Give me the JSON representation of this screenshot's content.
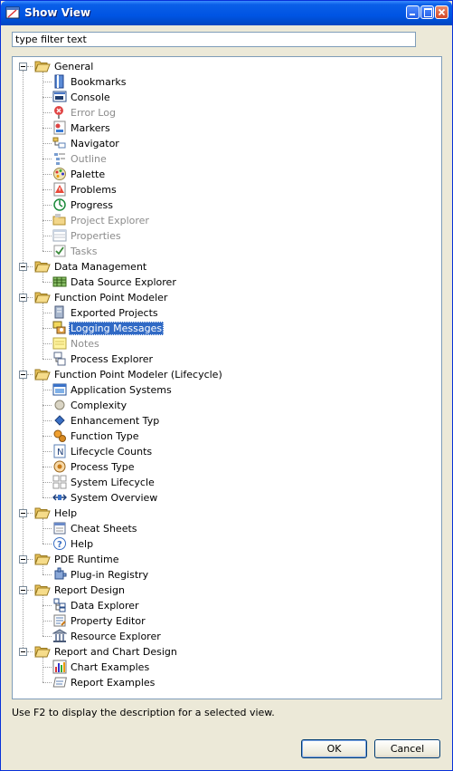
{
  "window": {
    "title": "Show View",
    "icon": "show-view-icon"
  },
  "filter": {
    "value": "type filter text"
  },
  "tree": [
    {
      "label": "General",
      "views": [
        {
          "label": "Bookmarks",
          "icon": "bookmarks-icon"
        },
        {
          "label": "Console",
          "icon": "console-icon"
        },
        {
          "label": "Error Log",
          "icon": "error-log-icon",
          "disabled": true
        },
        {
          "label": "Markers",
          "icon": "markers-icon"
        },
        {
          "label": "Navigator",
          "icon": "navigator-icon"
        },
        {
          "label": "Outline",
          "icon": "outline-icon",
          "disabled": true
        },
        {
          "label": "Palette",
          "icon": "palette-icon"
        },
        {
          "label": "Problems",
          "icon": "problems-icon"
        },
        {
          "label": "Progress",
          "icon": "progress-icon"
        },
        {
          "label": "Project Explorer",
          "icon": "project-explorer-icon",
          "disabled": true
        },
        {
          "label": "Properties",
          "icon": "properties-icon",
          "disabled": true
        },
        {
          "label": "Tasks",
          "icon": "tasks-icon",
          "disabled": true
        }
      ]
    },
    {
      "label": "Data Management",
      "views": [
        {
          "label": "Data Source Explorer",
          "icon": "data-source-explorer-icon"
        }
      ]
    },
    {
      "label": "Function Point Modeler",
      "views": [
        {
          "label": "Exported Projects",
          "icon": "exported-projects-icon"
        },
        {
          "label": "Logging Messages",
          "icon": "logging-messages-icon",
          "selected": true
        },
        {
          "label": "Notes",
          "icon": "notes-icon",
          "disabled": true
        },
        {
          "label": "Process Explorer",
          "icon": "process-explorer-icon"
        }
      ]
    },
    {
      "label": "Function Point Modeler (Lifecycle)",
      "views": [
        {
          "label": "Application Systems",
          "icon": "application-systems-icon"
        },
        {
          "label": "Complexity",
          "icon": "complexity-icon"
        },
        {
          "label": "Enhancement Typ",
          "icon": "enhancement-type-icon"
        },
        {
          "label": "Function Type",
          "icon": "function-type-icon"
        },
        {
          "label": "Lifecycle Counts",
          "icon": "lifecycle-counts-icon"
        },
        {
          "label": "Process Type",
          "icon": "process-type-icon"
        },
        {
          "label": "System Lifecycle",
          "icon": "system-lifecycle-icon"
        },
        {
          "label": "System Overview",
          "icon": "system-overview-icon"
        }
      ]
    },
    {
      "label": "Help",
      "views": [
        {
          "label": "Cheat Sheets",
          "icon": "cheat-sheets-icon"
        },
        {
          "label": "Help",
          "icon": "help-icon"
        }
      ]
    },
    {
      "label": "PDE Runtime",
      "views": [
        {
          "label": "Plug-in Registry",
          "icon": "plugin-registry-icon"
        }
      ]
    },
    {
      "label": "Report Design",
      "views": [
        {
          "label": "Data Explorer",
          "icon": "data-explorer-icon"
        },
        {
          "label": "Property Editor",
          "icon": "property-editor-icon"
        },
        {
          "label": "Resource Explorer",
          "icon": "resource-explorer-icon"
        }
      ]
    },
    {
      "label": "Report and Chart Design",
      "views": [
        {
          "label": "Chart Examples",
          "icon": "chart-examples-icon"
        },
        {
          "label": "Report Examples",
          "icon": "report-examples-icon"
        }
      ]
    }
  ],
  "status_text": "Use F2 to display the description for a selected view.",
  "buttons": {
    "ok": "OK",
    "cancel": "Cancel"
  },
  "colors": {
    "selection": "#316ac5",
    "title_bar": "#0054e3",
    "dialog_bg": "#ece9d8"
  }
}
